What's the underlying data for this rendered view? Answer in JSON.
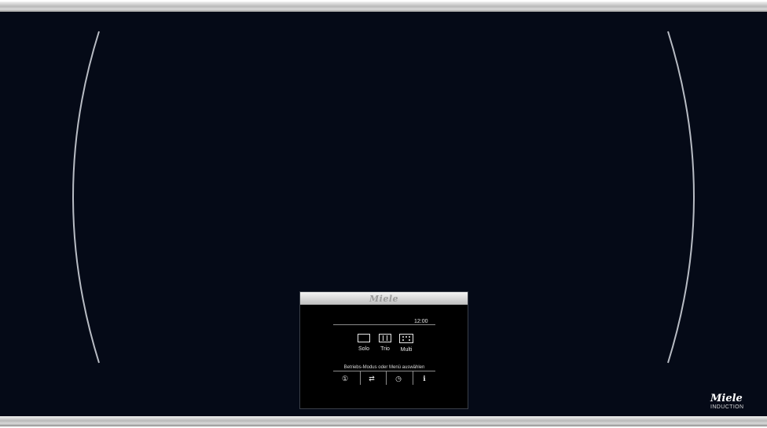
{
  "cooktop": {
    "brand": "Miele",
    "sub_brand": "INDUCTION",
    "panel_logo": "Miele",
    "colors": {
      "glass": "#050a17",
      "trim": "#c8c8c8",
      "zone_marking": "#b8bcc4",
      "display_text": "#e6e6e6"
    }
  },
  "display": {
    "time": "12:00",
    "modes": [
      {
        "label": "Solo",
        "icon": "solo-icon"
      },
      {
        "label": "Trio",
        "icon": "trio-icon"
      },
      {
        "label": "Multi",
        "icon": "multi-icon"
      }
    ],
    "prompt": "Betriebs-Modus oder Menü auswählen",
    "controls": [
      {
        "glyph": "①",
        "icon": "power-icon"
      },
      {
        "glyph": "⇄",
        "icon": "settings-icon"
      },
      {
        "glyph": "◷",
        "icon": "timer-icon"
      },
      {
        "glyph": "ℹ",
        "icon": "info-icon"
      }
    ]
  }
}
